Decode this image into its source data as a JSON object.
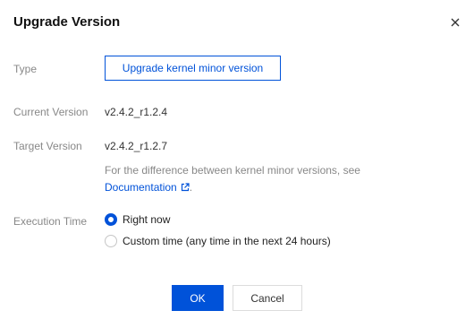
{
  "dialog": {
    "title": "Upgrade Version",
    "close_icon": "close-icon"
  },
  "type": {
    "label": "Type",
    "button_label": "Upgrade kernel minor version"
  },
  "current_version": {
    "label": "Current Version",
    "value": "v2.4.2_r1.2.4"
  },
  "target_version": {
    "label": "Target Version",
    "value": "v2.4.2_r1.2.7",
    "help_text": "For the difference between kernel minor versions, see",
    "link_text": "Documentation",
    "link_icon": "external-link-icon",
    "trailing": "."
  },
  "execution_time": {
    "label": "Execution Time",
    "options": [
      {
        "label": "Right now",
        "checked": true
      },
      {
        "label": "Custom time (any time in the next 24 hours)",
        "checked": false
      }
    ]
  },
  "footer": {
    "ok_label": "OK",
    "cancel_label": "Cancel"
  },
  "colors": {
    "primary": "#0052d9",
    "label_gray": "#888888",
    "border": "#dcdcdc"
  }
}
